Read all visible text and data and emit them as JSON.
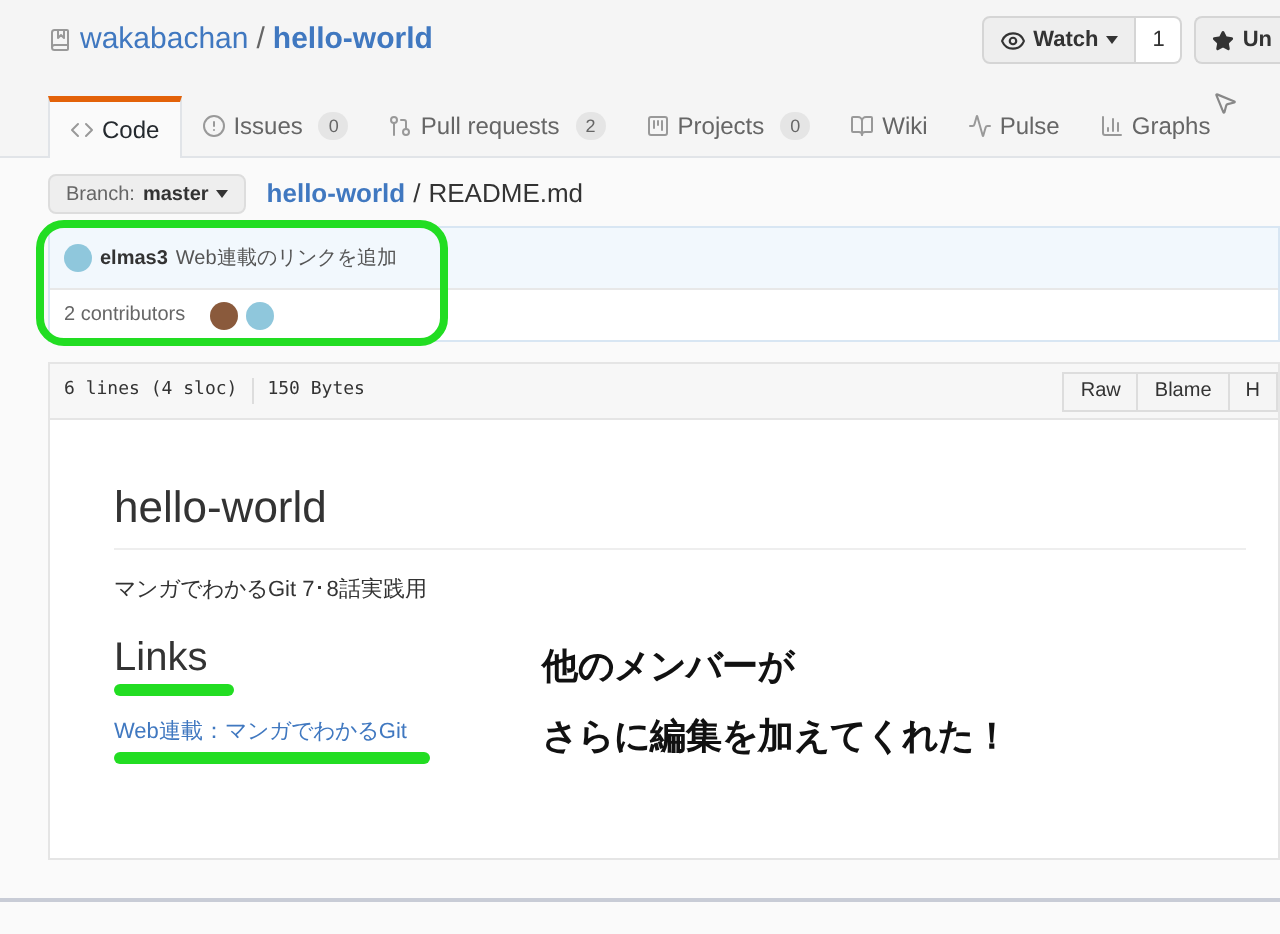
{
  "repo": {
    "owner": "wakabachan",
    "separator": "/",
    "name": "hello-world"
  },
  "header_buttons": [
    {
      "kind": "watch",
      "label": "Watch",
      "count": "1"
    },
    {
      "kind": "star",
      "label": "Un"
    }
  ],
  "tabs": [
    {
      "kind": "code",
      "label": "Code",
      "selected": true
    },
    {
      "kind": "issues",
      "label": "Issues",
      "count": "0",
      "selected": false
    },
    {
      "kind": "pulls",
      "label": "Pull requests",
      "count": "2",
      "selected": false
    },
    {
      "kind": "projects",
      "label": "Projects",
      "count": "0",
      "selected": false
    },
    {
      "kind": "wiki",
      "label": "Wiki",
      "selected": false
    },
    {
      "kind": "pulse",
      "label": "Pulse",
      "selected": false
    },
    {
      "kind": "graphs",
      "label": "Graphs",
      "selected": false
    }
  ],
  "branch": {
    "prefix": "Branch:",
    "name": "master"
  },
  "path": {
    "repo": "hello-world",
    "separator": "/",
    "file": "README.md"
  },
  "commit": {
    "author": "elmas3",
    "message": "Web連載のリンクを追加",
    "contributors": "2 contributors"
  },
  "file_header": {
    "lines": "6 lines (4 sloc)",
    "size": "150 Bytes",
    "buttons": [
      "Raw",
      "Blame",
      "H"
    ]
  },
  "readme": {
    "title": "hello-world",
    "paragraph": "マンガでわかるGit 7･8話実践用",
    "heading": "Links",
    "link": "Web連載：マンガでわかるGit"
  },
  "caption": [
    "他のメンバーが",
    "さらに編集を加えてくれた！"
  ]
}
